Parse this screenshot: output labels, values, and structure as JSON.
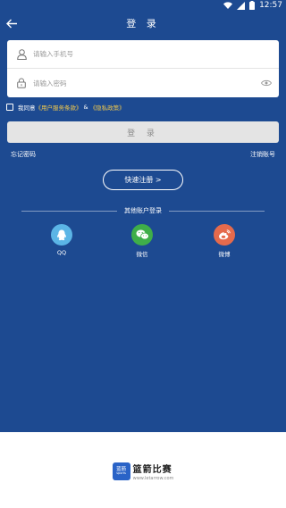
{
  "status_bar": {
    "time": "12:57"
  },
  "header": {
    "title": "登 录"
  },
  "form": {
    "phone_placeholder": "请输入手机号",
    "password_placeholder": "请输入密码"
  },
  "agreement": {
    "prefix": "我同意",
    "terms_link": "《用户服务条款》",
    "and": "&",
    "privacy_link": "《隐私政策》"
  },
  "login_button": "登 录",
  "forgot_password": "忘记密码",
  "cancel_account": "注销账号",
  "quick_register": "快速注册 >",
  "other_login": {
    "title": "其他账户登录",
    "options": [
      {
        "label": "QQ",
        "icon": "qq-icon",
        "color": "#5bb5e6"
      },
      {
        "label": "微信",
        "icon": "wechat-icon",
        "color": "#3fae49"
      },
      {
        "label": "微博",
        "icon": "weibo-icon",
        "color": "#e56a4c"
      }
    ]
  },
  "brand": {
    "logo_text_top": "蓝箭",
    "logo_text_bottom": "sports",
    "name": "篮箭比赛",
    "url": "www.letarrow.com"
  },
  "colors": {
    "primary": "#1d4a91",
    "link": "#f2c94c",
    "button_disabled": "#e4e4e4"
  }
}
